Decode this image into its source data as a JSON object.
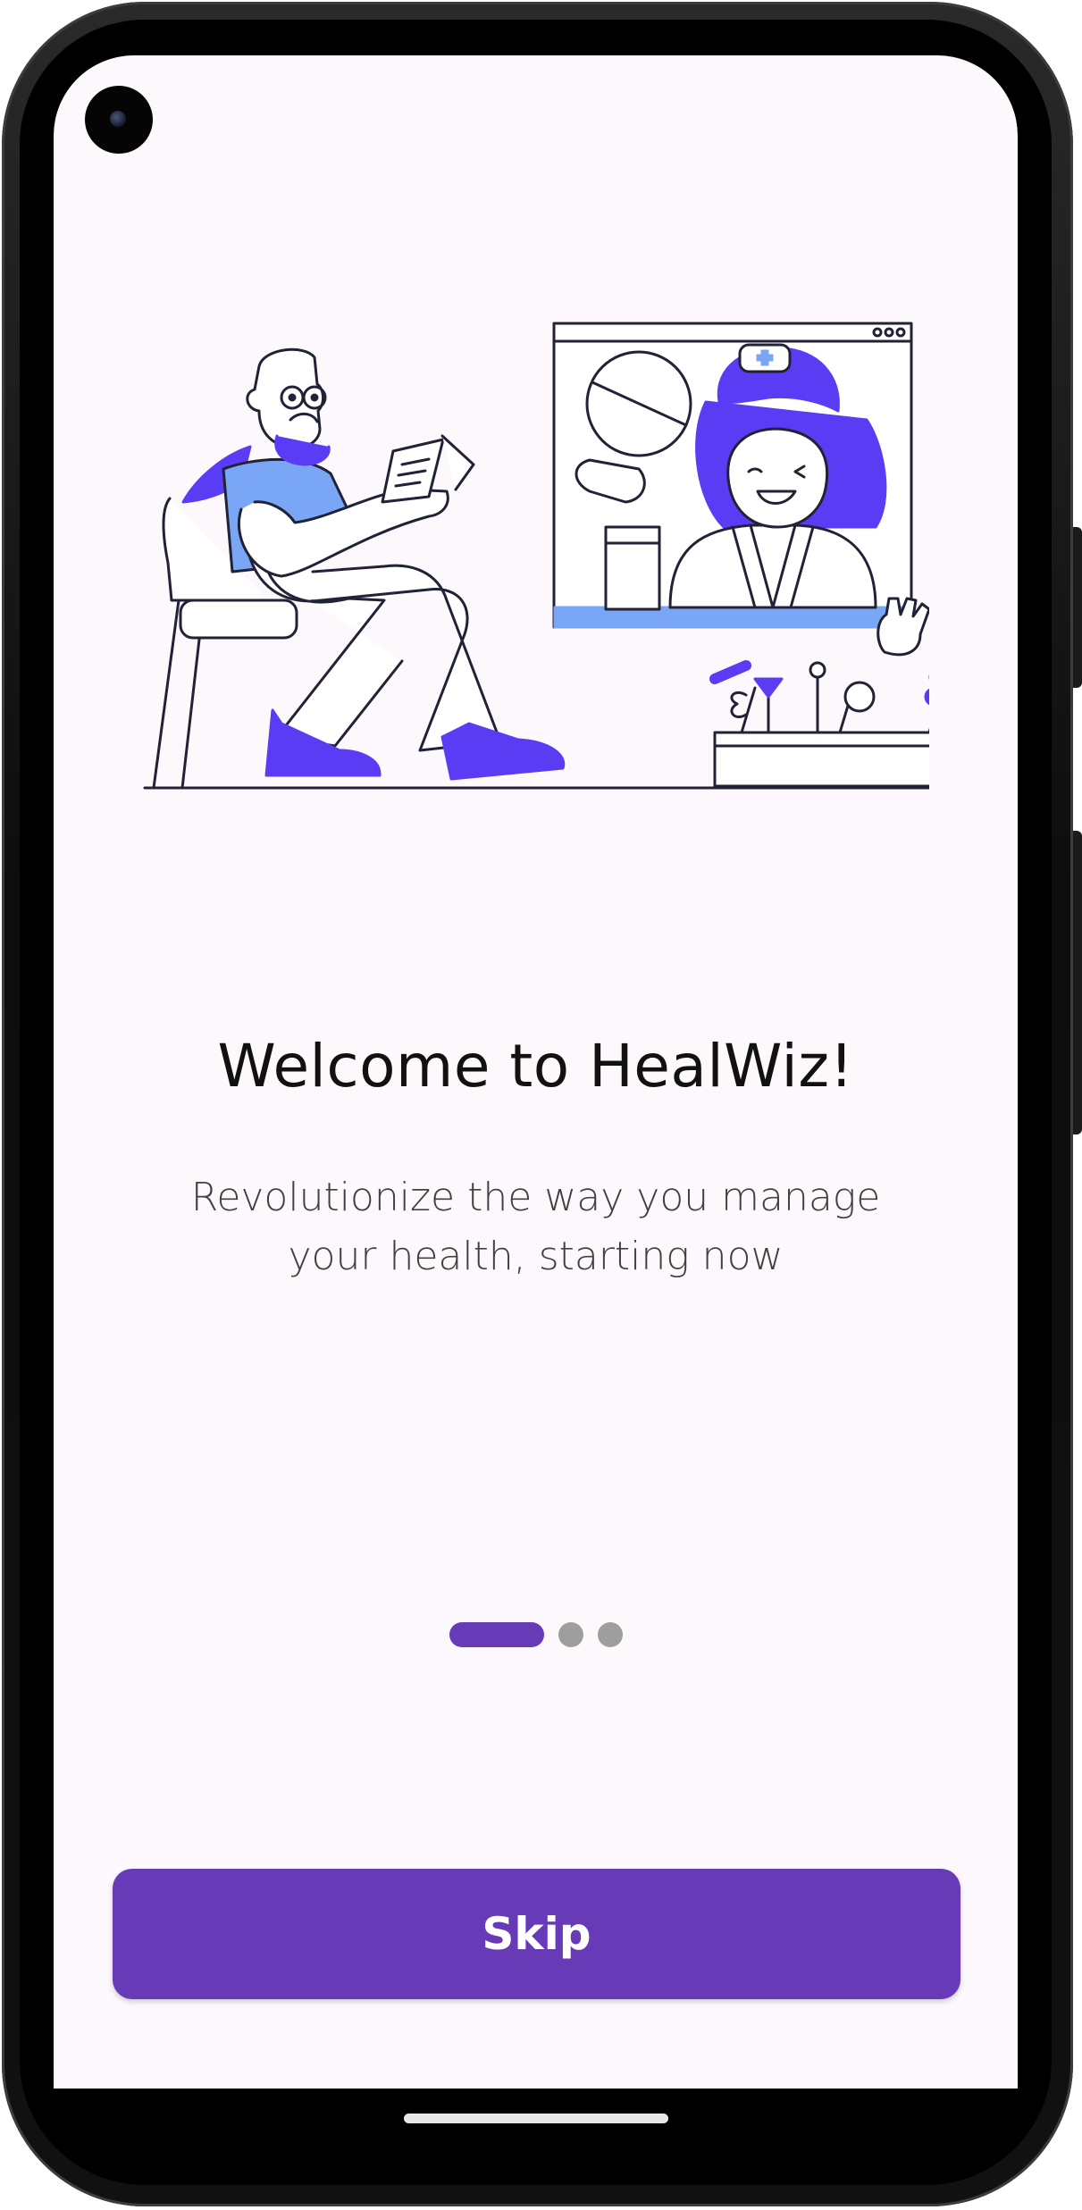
{
  "onboarding": {
    "title": "Welcome to HealWiz!",
    "subtitle": "Revolutionize the way you manage your health, starting now",
    "pager": {
      "total_pages": 3,
      "current_page": 1
    },
    "skip_label": "Skip"
  },
  "illustration": {
    "description_icon": "telemedicine-consultation-illustration",
    "icons": [
      "patient-figure-icon",
      "doctor-video-call-icon",
      "pill-icon",
      "plant-pot-icon"
    ]
  },
  "colors": {
    "accent": "#673ab7",
    "illustration_purple": "#5b3cf5",
    "illustration_blue": "#7aa7f5",
    "background": "#fcf8fc",
    "text": "#111111",
    "pager_inactive": "#9e9e9e"
  }
}
